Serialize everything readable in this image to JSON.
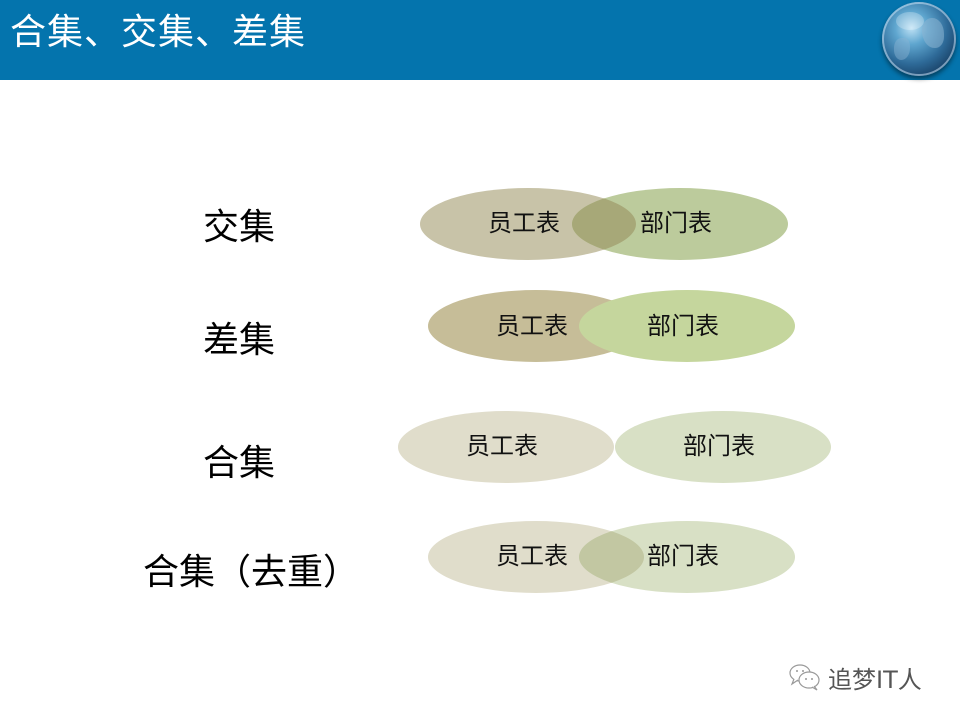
{
  "header": {
    "title": "合集、交集、差集",
    "logo_icon": "globe-icon",
    "background_color": "#0474ad"
  },
  "rows": [
    {
      "id": "intersection",
      "label": "交集",
      "left_set": "员工表",
      "right_set": "部门表",
      "highlight": "intersection",
      "colors": {
        "left": "#c8c3a8",
        "right": "#bccb9c",
        "overlap": "#a7a878"
      }
    },
    {
      "id": "difference",
      "label": "差集",
      "left_set": "员工表",
      "right_set": "部门表",
      "highlight": "left-only",
      "colors": {
        "left": "#c6bd98",
        "right": "#c5d69d"
      }
    },
    {
      "id": "union",
      "label": "合集",
      "left_set": "员工表",
      "right_set": "部门表",
      "highlight": "both-separate",
      "colors": {
        "left": "#e0ddcb",
        "right": "#d8e0c5"
      }
    },
    {
      "id": "union-distinct",
      "label": "合集（去重）",
      "left_set": "员工表",
      "right_set": "部门表",
      "highlight": "union-overlap",
      "colors": {
        "left": "#e0ddcb",
        "right": "#d8e0c5",
        "overlap": "#c2c7a2"
      }
    }
  ],
  "watermark": {
    "icon": "wechat-icon",
    "text": "追梦IT人"
  }
}
